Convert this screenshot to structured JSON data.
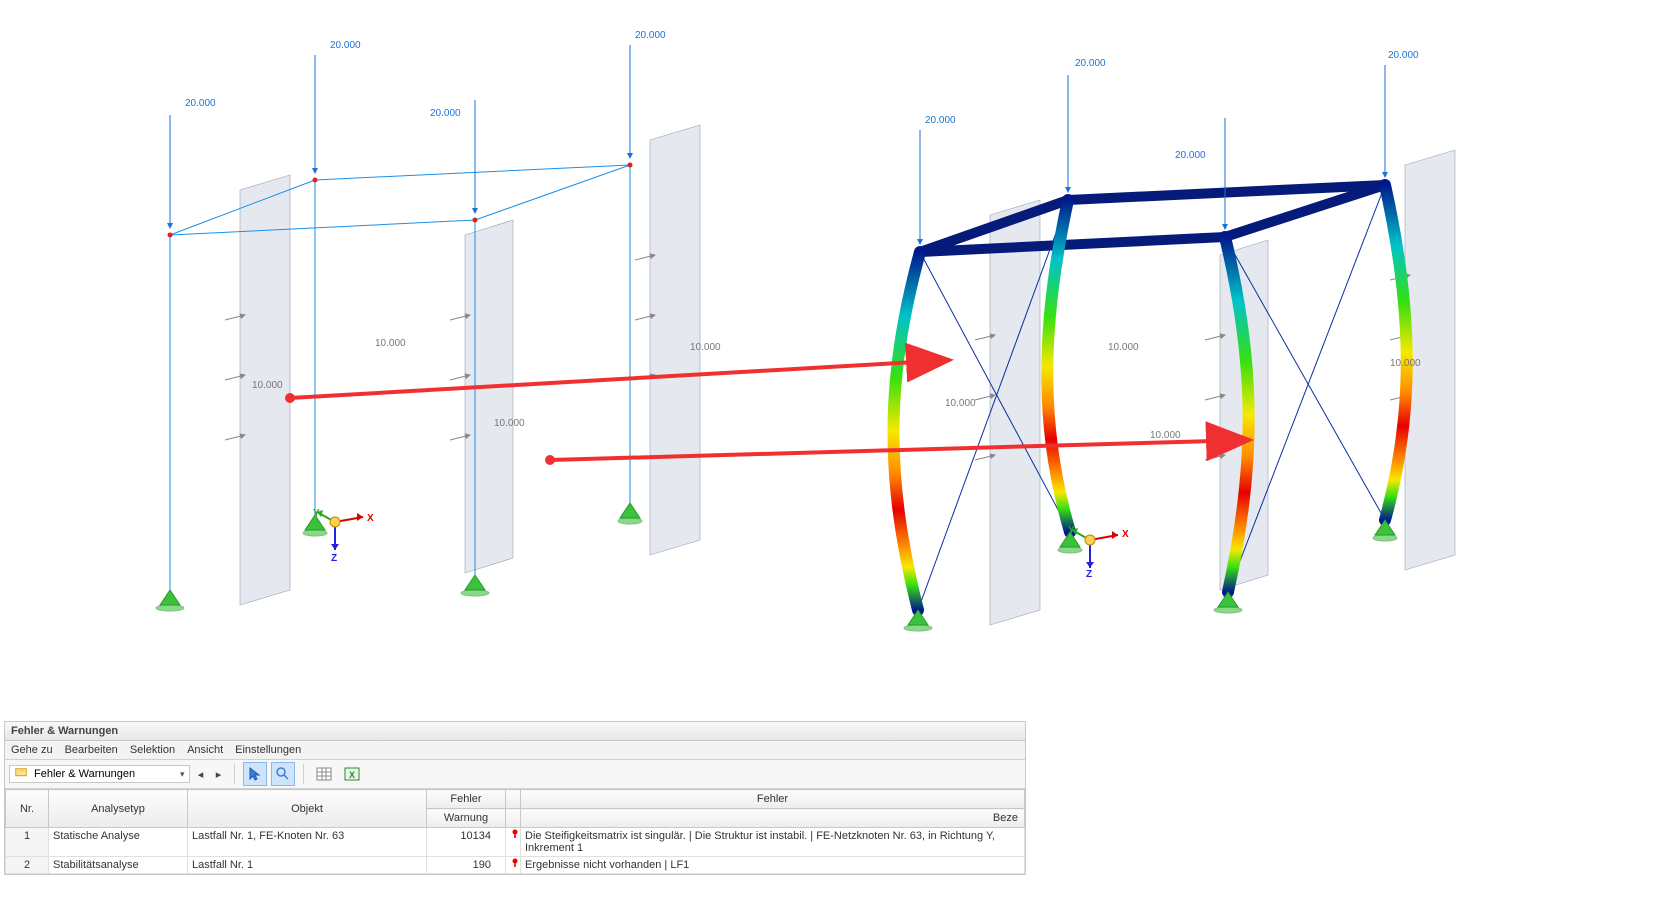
{
  "loads": {
    "top": "20.000",
    "side": "10.000"
  },
  "axes": {
    "x": "X",
    "y": "Y",
    "z": "Z"
  },
  "panel": {
    "title": "Fehler & Warnungen",
    "menu": [
      "Gehe zu",
      "Bearbeiten",
      "Selektion",
      "Ansicht",
      "Einstellungen"
    ],
    "filter_value": "Fehler & Warnungen",
    "columns": {
      "nr": "Nr.",
      "analysetyp": "Analysetyp",
      "objekt": "Objekt",
      "fehler1": "Fehler",
      "warnung": "Warnung",
      "fehler2": "Fehler",
      "beze": "Beze"
    },
    "rows": [
      {
        "nr": "1",
        "analysetyp": "Statische Analyse",
        "objekt": "Lastfall Nr. 1, FE-Knoten Nr. 63",
        "code": "10134",
        "msg": "Die Steifigkeitsmatrix ist singulär.  |   Die Struktur ist instabil. | FE-Netzknoten Nr. 63, in Richtung Y, Inkrement 1"
      },
      {
        "nr": "2",
        "analysetyp": "Stabilitätsanalyse",
        "objekt": "Lastfall Nr. 1",
        "code": "190",
        "msg": "Ergebnisse nicht vorhanden | LF1"
      }
    ]
  }
}
